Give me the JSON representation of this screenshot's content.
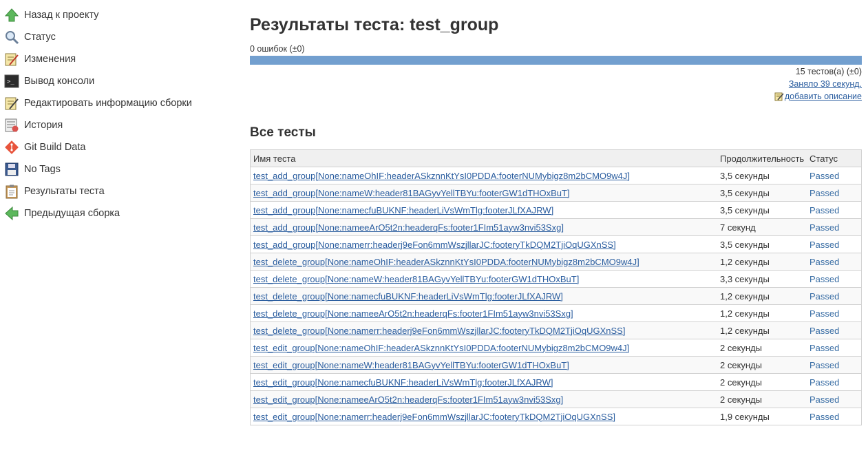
{
  "sidebar": {
    "items": [
      {
        "label": "Назад к проекту",
        "icon": "up-arrow-icon"
      },
      {
        "label": "Статус",
        "icon": "magnifier-icon"
      },
      {
        "label": "Изменения",
        "icon": "notepad-icon"
      },
      {
        "label": "Вывод консоли",
        "icon": "terminal-icon"
      },
      {
        "label": "Редактировать информацию сборки",
        "icon": "notepad-edit-icon"
      },
      {
        "label": "История",
        "icon": "history-icon"
      },
      {
        "label": "Git Build Data",
        "icon": "git-icon"
      },
      {
        "label": "No Tags",
        "icon": "floppy-icon"
      },
      {
        "label": "Результаты теста",
        "icon": "clipboard-icon"
      },
      {
        "label": "Предыдущая сборка",
        "icon": "left-arrow-icon"
      }
    ]
  },
  "main": {
    "title": "Результаты теста: test_group",
    "failures": "0 ошибок (±0)",
    "progress_pass_fraction": 1.0,
    "test_count": "15 тестов(а) (±0)",
    "duration_link": "Заняло 39 секунд.",
    "add_description": "добавить описание",
    "section_title": "Все тесты",
    "table": {
      "headers": {
        "name": "Имя теста",
        "duration": "Продолжительность",
        "status": "Статус"
      },
      "rows": [
        {
          "name": "test_add_group[None:nameOhIF:headerASkznnKtYsI0PDDA:footerNUMybigz8m2bCMO9w4J]",
          "duration": "3,5 секунды",
          "status": "Passed"
        },
        {
          "name": "test_add_group[None:nameW:header81BAGyvYellTBYu:footerGW1dTHOxBuT]",
          "duration": "3,5 секунды",
          "status": "Passed"
        },
        {
          "name": "test_add_group[None:namecfuBUKNF:headerLiVsWmTlg:footerJLfXAJRW]",
          "duration": "3,5 секунды",
          "status": "Passed"
        },
        {
          "name": "test_add_group[None:nameeArO5t2n:headerqFs:footer1FIm51ayw3nvi53Sxg]",
          "duration": "7 секунд",
          "status": "Passed"
        },
        {
          "name": "test_add_group[None:namerr:headerj9eFon6mmWszjllarJC:footeryTkDQM2TjiOqUGXnSS]",
          "duration": "3,5 секунды",
          "status": "Passed"
        },
        {
          "name": "test_delete_group[None:nameOhIF:headerASkznnKtYsI0PDDA:footerNUMybigz8m2bCMO9w4J]",
          "duration": "1,2 секунды",
          "status": "Passed"
        },
        {
          "name": "test_delete_group[None:nameW:header81BAGyvYellTBYu:footerGW1dTHOxBuT]",
          "duration": "3,3 секунды",
          "status": "Passed"
        },
        {
          "name": "test_delete_group[None:namecfuBUKNF:headerLiVsWmTlg:footerJLfXAJRW]",
          "duration": "1,2 секунды",
          "status": "Passed"
        },
        {
          "name": "test_delete_group[None:nameeArO5t2n:headerqFs:footer1FIm51ayw3nvi53Sxg]",
          "duration": "1,2 секунды",
          "status": "Passed"
        },
        {
          "name": "test_delete_group[None:namerr:headerj9eFon6mmWszjllarJC:footeryTkDQM2TjiOqUGXnSS]",
          "duration": "1,2 секунды",
          "status": "Passed"
        },
        {
          "name": "test_edit_group[None:nameOhIF:headerASkznnKtYsI0PDDA:footerNUMybigz8m2bCMO9w4J]",
          "duration": "2 секунды",
          "status": "Passed"
        },
        {
          "name": "test_edit_group[None:nameW:header81BAGyvYellTBYu:footerGW1dTHOxBuT]",
          "duration": "2 секунды",
          "status": "Passed"
        },
        {
          "name": "test_edit_group[None:namecfuBUKNF:headerLiVsWmTlg:footerJLfXAJRW]",
          "duration": "2 секунды",
          "status": "Passed"
        },
        {
          "name": "test_edit_group[None:nameeArO5t2n:headerqFs:footer1FIm51ayw3nvi53Sxg]",
          "duration": "2 секунды",
          "status": "Passed"
        },
        {
          "name": "test_edit_group[None:namerr:headerj9eFon6mmWszjllarJC:footeryTkDQM2TjiOqUGXnSS]",
          "duration": "1,9 секунды",
          "status": "Passed"
        }
      ]
    }
  },
  "colors": {
    "progress_pass": "#729fcf",
    "link": "#2a5d9f",
    "status_passed": "#3a6ea5"
  }
}
